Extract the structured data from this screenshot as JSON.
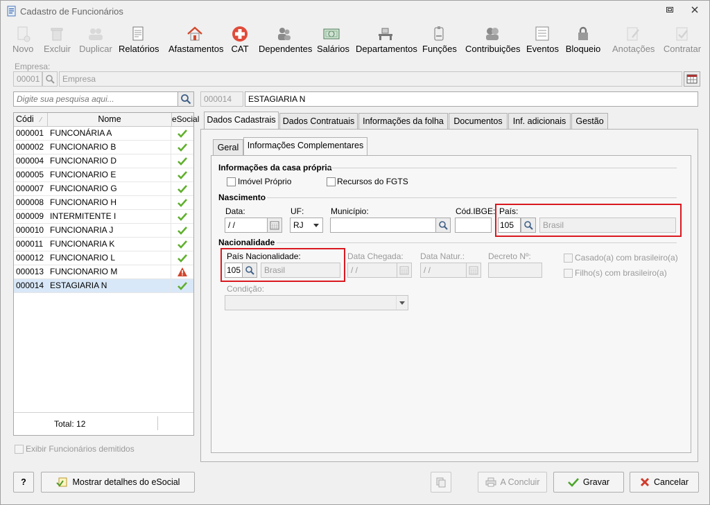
{
  "window": {
    "title": "Cadastro de Funcionários",
    "controls": [
      "restore",
      "close"
    ]
  },
  "toolbar": [
    {
      "id": "novo",
      "label": "Novo",
      "icon": "new-document-icon",
      "enabled": false
    },
    {
      "id": "excluir",
      "label": "Excluir",
      "icon": "trash-icon",
      "enabled": false
    },
    {
      "id": "duplicar",
      "label": "Duplicar",
      "icon": "users-icon",
      "enabled": false
    },
    {
      "id": "relatorios",
      "label": "Relatórios",
      "icon": "report-icon",
      "enabled": true
    },
    {
      "id": "afastamentos",
      "label": "Afastamentos",
      "icon": "house-icon",
      "enabled": true
    },
    {
      "id": "cat",
      "label": "CAT",
      "icon": "medical-cross-icon",
      "enabled": true
    },
    {
      "id": "dependentes",
      "label": "Dependentes",
      "icon": "family-icon",
      "enabled": true
    },
    {
      "id": "salarios",
      "label": "Salários",
      "icon": "money-icon",
      "enabled": true
    },
    {
      "id": "departamentos",
      "label": "Departamentos",
      "icon": "desk-icon",
      "enabled": true
    },
    {
      "id": "funcoes",
      "label": "Funções",
      "icon": "badge-icon",
      "enabled": true
    },
    {
      "id": "contribuicoes",
      "label": "Contribuições",
      "icon": "people-icon",
      "enabled": true
    },
    {
      "id": "eventos",
      "label": "Eventos",
      "icon": "list-icon",
      "enabled": true
    },
    {
      "id": "bloqueio",
      "label": "Bloqueio",
      "icon": "lock-icon",
      "enabled": true
    },
    {
      "id": "anotacoes",
      "label": "Anotações",
      "icon": "notes-icon",
      "enabled": false
    },
    {
      "id": "contratar",
      "label": "Contratar",
      "icon": "hire-icon",
      "enabled": false
    }
  ],
  "empresa": {
    "label": "Empresa:",
    "code": "00001",
    "name_placeholder": "Empresa"
  },
  "search": {
    "placeholder": "Digite sua pesquisa aqui..."
  },
  "current": {
    "code": "000014",
    "name": "ESTAGIARIA N"
  },
  "grid": {
    "columns": [
      "Códi",
      "Nome",
      "eSocial"
    ],
    "rows": [
      {
        "code": "000001",
        "name": "FUNCONÁRIA A",
        "status": "ok"
      },
      {
        "code": "000002",
        "name": "FUNCIONARIO B",
        "status": "ok"
      },
      {
        "code": "000004",
        "name": "FUNCIONARIO D",
        "status": "ok"
      },
      {
        "code": "000005",
        "name": "FUNCIONARIO E",
        "status": "ok"
      },
      {
        "code": "000007",
        "name": "FUNCIONARIO G",
        "status": "ok"
      },
      {
        "code": "000008",
        "name": "FUNCIONARIO H",
        "status": "ok"
      },
      {
        "code": "000009",
        "name": "INTERMITENTE I",
        "status": "ok"
      },
      {
        "code": "000010",
        "name": "FUNCIONARIA J",
        "status": "ok"
      },
      {
        "code": "000011",
        "name": "FUNCIONARIA K",
        "status": "ok"
      },
      {
        "code": "000012",
        "name": "FUNCIONARIO L",
        "status": "ok"
      },
      {
        "code": "000013",
        "name": "FUNCIONARIO M",
        "status": "warning"
      },
      {
        "code": "000014",
        "name": "ESTAGIARIA N",
        "status": "ok"
      }
    ],
    "total_label": "Total: 12"
  },
  "show_dismissed_label": "Exibir Funcionários demitidos",
  "tabs": [
    "Dados Cadastrais",
    "Dados Contratuais",
    "Informações da folha",
    "Documentos",
    "Inf. adicionais",
    "Gestão"
  ],
  "subtabs": [
    "Geral",
    "Informações Complementares"
  ],
  "casa_propria": {
    "title": "Informações da casa própria",
    "imovel_label": "Imóvel Próprio",
    "fgts_label": "Recursos do FGTS"
  },
  "nascimento": {
    "title": "Nascimento",
    "data_label": "Data:",
    "data_value": " / /",
    "uf_label": "UF:",
    "uf_value": "RJ",
    "municipio_label": "Município:",
    "ibge_label": "Cód.IBGE:",
    "pais_label": "País:",
    "pais_code": "105",
    "pais_name": "Brasil"
  },
  "nacionalidade": {
    "title": "Nacionalidade",
    "pais_label": "País Nacionalidade:",
    "pais_code": "105",
    "pais_name": "Brasil",
    "chegada_label": "Data Chegada:",
    "chegada_value": " / /",
    "natur_label": "Data Natur.:",
    "natur_value": " / /",
    "decreto_label": "Decreto Nº:",
    "casado_label": "Casado(a) com brasileiro(a)",
    "filhos_label": "Filho(s) com brasileiro(a)",
    "condicao_label": "Condição:"
  },
  "footer": {
    "help_label": "?",
    "esocial_label": "Mostrar detalhes do eSocial",
    "concluir_label": "A Concluir",
    "gravar_label": "Gravar",
    "cancelar_label": "Cancelar"
  },
  "colors": {
    "highlight_box": "#d9181f",
    "selected_row": "#d9e8f8",
    "ok_check": "#5fb02c",
    "warning": "#d0452b"
  }
}
